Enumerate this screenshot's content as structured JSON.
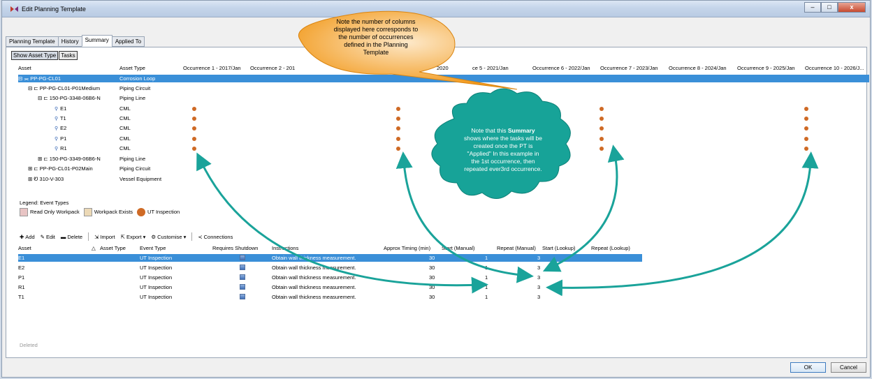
{
  "window": {
    "title": "Edit Planning Template",
    "min": "‒",
    "max": "□",
    "close": "x"
  },
  "tabs": [
    "Planning Template",
    "History",
    "Summary",
    "Applied To"
  ],
  "toolbar": {
    "show_asset_type": "Show Asset Type",
    "tasks": "Tasks"
  },
  "grid": {
    "col_asset": "Asset",
    "col_asset_type": "Asset Type",
    "occurrences": [
      "Occurrence 1 - 2017/Jan",
      "Occurrence 2 - 201",
      "2020",
      "ce 5 - 2021/Jan",
      "Occurrence 6 - 2022/Jan",
      "Occurrence 7 - 2023/Jan",
      "Occurrence 8 - 2024/Jan",
      "Occurrence 9 - 2025/Jan",
      "Occurrence 10 - 2026/J..."
    ],
    "rows": [
      {
        "name": "PP-PG-CL01",
        "type": "Corrosion Loop"
      },
      {
        "name": "PP-PG-CL01-P01Medium",
        "type": "Piping Circuit"
      },
      {
        "name": "150-PG-3348-06B6-N",
        "type": "Piping Line"
      },
      {
        "name": "E1",
        "type": "CML"
      },
      {
        "name": "T1",
        "type": "CML"
      },
      {
        "name": "E2",
        "type": "CML"
      },
      {
        "name": "P1",
        "type": "CML"
      },
      {
        "name": "R1",
        "type": "CML"
      },
      {
        "name": "150-PG-3349-06B6-N",
        "type": "Piping Line"
      },
      {
        "name": "PP-PG-CL01-P02Main",
        "type": "Piping Circuit"
      },
      {
        "name": "310-V-303",
        "type": "Vessel Equipment"
      }
    ]
  },
  "legend": {
    "title": "Legend: Event Types",
    "read_only": "Read Only Workpack",
    "exists": "Workpack Exists",
    "ut": "UT Inspection"
  },
  "task_toolbar": {
    "add": "Add",
    "edit": "Edit",
    "delete": "Delete",
    "import": "Import",
    "export": "Export",
    "customise": "Customise",
    "connections": "Connections"
  },
  "tasks": {
    "headers": {
      "asset": "Asset",
      "asset_type": "Asset Type",
      "event_type": "Event Type",
      "shutdown": "Requires Shutdown",
      "instructions": "Instructions",
      "timing": "Approx Timing (min)",
      "start_manual": "Start (Manual)",
      "repeat_manual": "Repeat (Manual)",
      "start_lookup": "Start (Lookup)",
      "repeat_lookup": "Repeat (Lookup)"
    },
    "rows": [
      {
        "asset": "E1",
        "event": "UT Inspection",
        "instr": "Obtain wall thickness measurement.",
        "timing": "30",
        "start": "1",
        "repeat": "3"
      },
      {
        "asset": "E2",
        "event": "UT Inspection",
        "instr": "Obtain wall thickness measurement.",
        "timing": "30",
        "start": "1",
        "repeat": "3"
      },
      {
        "asset": "P1",
        "event": "UT Inspection",
        "instr": "Obtain wall thickness measurement.",
        "timing": "30",
        "start": "1",
        "repeat": "3"
      },
      {
        "asset": "R1",
        "event": "UT Inspection",
        "instr": "Obtain wall thickness measurement.",
        "timing": "30",
        "start": "1",
        "repeat": "3"
      },
      {
        "asset": "T1",
        "event": "UT Inspection",
        "instr": "Obtain wall thickness measurement.",
        "timing": "30",
        "start": "1",
        "repeat": "3"
      }
    ]
  },
  "deleted": "Deleted",
  "buttons": {
    "ok": "OK",
    "cancel": "Cancel"
  },
  "callout": {
    "line1": "Note the number of columns",
    "line2": "displayed here corresponds to",
    "line3": "the number of occurrences",
    "line4": "defined in the Planning",
    "line5": "Template"
  },
  "cloud": {
    "line1a": "Note that this ",
    "line1b": "Summary",
    "line2": "shows where the tasks will be",
    "line3": "created once the PT is",
    "line4": "\"Applied\"  In this example in",
    "line5": "the 1st occurrence, then",
    "line6": "repeated ever3rd occurrence."
  },
  "colors": {
    "selection": "#3a8fd8",
    "dot": "#cf6a25",
    "callout": "#f29a1d",
    "cloud": "#17a398",
    "arrow": "#1aa39a"
  }
}
